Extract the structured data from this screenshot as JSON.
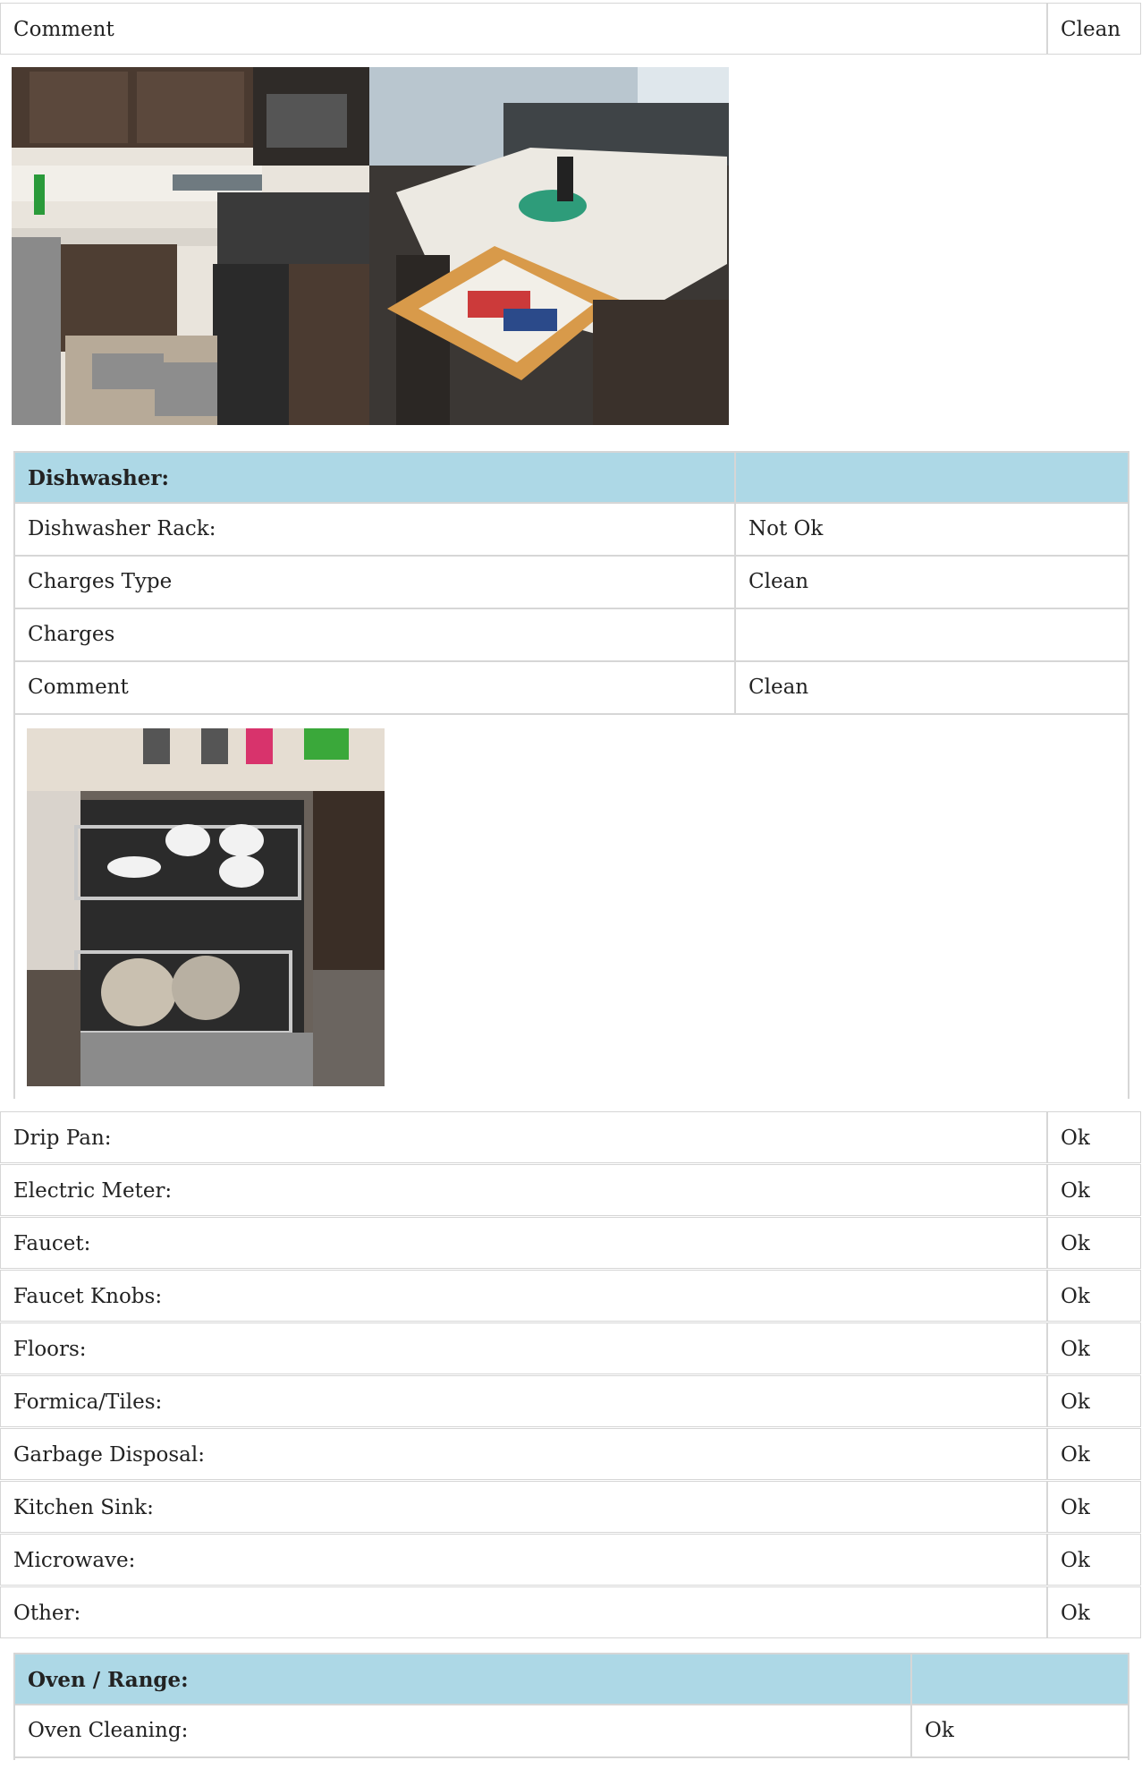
{
  "top_row": {
    "label": "Comment",
    "value": "Clean"
  },
  "dishwasher": {
    "title": "Dishwasher:",
    "rows": [
      {
        "label": "Dishwasher Rack:",
        "value": "Not Ok"
      },
      {
        "label": "Charges Type",
        "value": "Clean"
      },
      {
        "label": "Charges",
        "value": ""
      },
      {
        "label": "Comment",
        "value": "Clean"
      }
    ]
  },
  "items": [
    {
      "label": "Drip Pan:",
      "value": "Ok"
    },
    {
      "label": "Electric Meter:",
      "value": "Ok"
    },
    {
      "label": "Faucet:",
      "value": "Ok"
    },
    {
      "label": "Faucet Knobs:",
      "value": "Ok"
    },
    {
      "label": "Floors:",
      "value": "Ok"
    },
    {
      "label": "Formica/Tiles:",
      "value": "Ok"
    },
    {
      "label": "Garbage Disposal:",
      "value": "Ok"
    },
    {
      "label": "Kitchen Sink:",
      "value": "Ok"
    },
    {
      "label": "Microwave:",
      "value": "Ok"
    },
    {
      "label": "Other:",
      "value": "Ok"
    }
  ],
  "oven": {
    "title": "Oven / Range:",
    "rows": [
      {
        "label": "Oven Cleaning:",
        "value": "Ok"
      }
    ]
  },
  "photos": [
    "kitchen-photo",
    "island-drawer-photo",
    "dishwasher-photo"
  ]
}
